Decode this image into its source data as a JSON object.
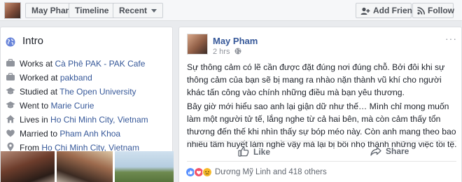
{
  "topbar": {
    "name": "May Pham",
    "timeline": "Timeline",
    "recent": "Recent",
    "add_friend": "Add Friend",
    "follow": "Follow"
  },
  "intro": {
    "title": "Intro",
    "items": [
      {
        "icon": "briefcase-icon",
        "prefix": "Works at ",
        "link": "Cà Phê PAK - PAK Cafe"
      },
      {
        "icon": "briefcase-icon",
        "prefix": "Worked at ",
        "link": "pakband"
      },
      {
        "icon": "graduation-cap-icon",
        "prefix": "Studied at ",
        "link": "The Open University"
      },
      {
        "icon": "graduation-cap-icon",
        "prefix": "Went to ",
        "link": "Marie Curie"
      },
      {
        "icon": "home-icon",
        "prefix": "Lives in ",
        "link": "Ho Chi Minh City, Vietnam"
      },
      {
        "icon": "heart-icon",
        "prefix": "Married to ",
        "link": "Pham Anh Khoa"
      },
      {
        "icon": "location-pin-icon",
        "prefix": "From ",
        "link": "Ho Chi Minh City, Vietnam"
      }
    ]
  },
  "post": {
    "author": "May Pham",
    "time": "2 hrs",
    "menu": "···",
    "paragraphs": [
      "Sự thông cảm có lẽ cần được đặt đúng nơi đúng chỗ. Bởi đôi khi sự thông cảm của bạn sẽ bị mang ra nhào nặn thành vũ khí cho người khác tấn công vào chính những điều mà bạn yêu thương.",
      "Bây giờ mới hiểu sao anh lại giận dữ như thế… Mình chỉ mong muốn làm một người tử tế, lắng nghe từ cả hai bên, mà còn cảm thấy tổn thương đến thế khi nhìn thấy sự bóp méo này. Còn anh mang theo bao nhiêu tâm huyết làm nghề vậy mà lại bị bôi nhọ thành những việc tồi tệ."
    ],
    "like": "Like",
    "share": "Share",
    "reactions_text": "Dương Mỹ Linh and 418 others"
  },
  "colors": {
    "link": "#365899",
    "like_blue": "#5890ff",
    "love_red": "#f25268",
    "sad_yellow": "#f7b928"
  }
}
